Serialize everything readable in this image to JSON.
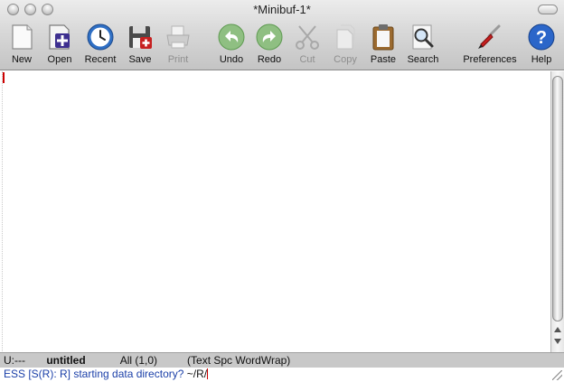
{
  "window": {
    "title": "*Minibuf-1*"
  },
  "toolbar": {
    "items": [
      {
        "label": "New",
        "icon": "new-document-icon",
        "enabled": true
      },
      {
        "label": "Open",
        "icon": "open-file-icon",
        "enabled": true
      },
      {
        "label": "Recent",
        "icon": "clock-icon",
        "enabled": true
      },
      {
        "label": "Save",
        "icon": "save-disk-icon",
        "enabled": true
      },
      {
        "label": "Print",
        "icon": "printer-icon",
        "enabled": false
      },
      {
        "label": "Undo",
        "icon": "undo-arrow-icon",
        "enabled": true
      },
      {
        "label": "Redo",
        "icon": "redo-arrow-icon",
        "enabled": true
      },
      {
        "label": "Cut",
        "icon": "scissors-icon",
        "enabled": false
      },
      {
        "label": "Copy",
        "icon": "copy-icon",
        "enabled": false
      },
      {
        "label": "Paste",
        "icon": "clipboard-icon",
        "enabled": true
      },
      {
        "label": "Search",
        "icon": "magnifier-icon",
        "enabled": true
      },
      {
        "label": "Preferences",
        "icon": "screwdriver-icon",
        "enabled": true
      },
      {
        "label": "Help",
        "icon": "help-question-icon",
        "enabled": true
      }
    ]
  },
  "modeline": {
    "status": "U:---",
    "buffer": "untitled",
    "position": "All (1,0)",
    "modes": "(Text Spc WordWrap)"
  },
  "minibuffer": {
    "prompt": "ESS [S(R): R] starting data directory?",
    "input": "~/R/"
  },
  "colors": {
    "minibuffer_prompt": "#1a3fa8",
    "cursor": "#cc0000",
    "modeline_bg": "#c8c8c8"
  }
}
